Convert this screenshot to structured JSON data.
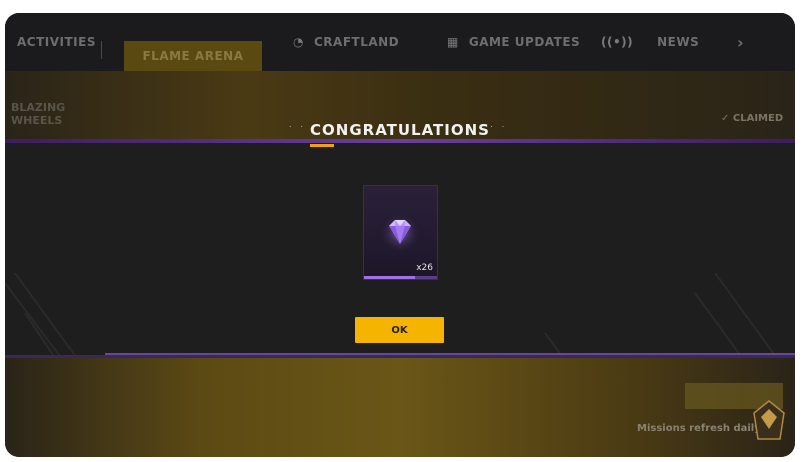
{
  "nav": {
    "tabs": [
      {
        "label": "ACTIVITIES",
        "icon": "",
        "active": false
      },
      {
        "label": "FLAME ARENA",
        "icon": "",
        "active": true
      },
      {
        "label": "CRAFTLAND",
        "icon": "craftland-icon",
        "active": false
      },
      {
        "label": "GAME UPDATES",
        "icon": "calendar-icon",
        "active": false
      },
      {
        "label": "NEWS",
        "icon": "broadcast-icon",
        "active": false
      }
    ],
    "next_arrow": "›"
  },
  "background": {
    "side_label": "BLAZING\nWHEELS",
    "status_label": "CLAIMED",
    "footer_text": "Missions refresh daily at"
  },
  "modal": {
    "title": "CONGRATULATIONS",
    "reward": {
      "item": "diamond-icon",
      "quantity": "x26",
      "rarity_color": "#9f70e8",
      "progress": 0.7
    },
    "ok_label": "OK"
  },
  "colors": {
    "accent": "#f4b400",
    "modal_bg": "#1e1e1e",
    "purple": "#7a50c0"
  }
}
